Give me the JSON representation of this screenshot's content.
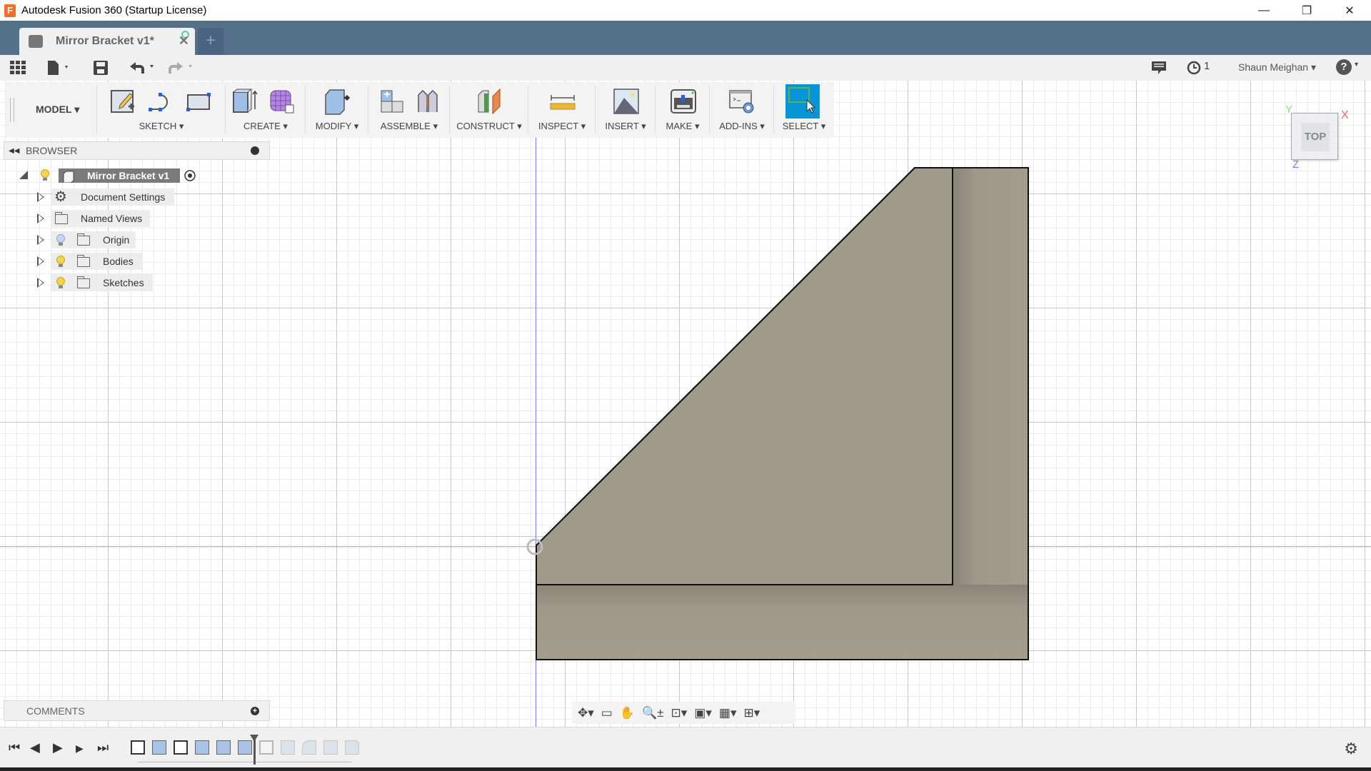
{
  "window": {
    "title": "Autodesk Fusion 360 (Startup License)",
    "logo": "F",
    "controls": {
      "minimize": "—",
      "restore": "❐",
      "close": "✕"
    }
  },
  "tabs": {
    "active": {
      "label": "Mirror Bracket v1*",
      "icon": "cube-icon",
      "close": "✕"
    },
    "new_tab": "+"
  },
  "quick_access": {
    "data_panel": "data-panel-icon",
    "file": "file-icon",
    "save": "save-icon",
    "undo": "undo-icon",
    "redo": "redo-icon",
    "notifications": "comment-icon",
    "job_status": "1",
    "user": "Shaun Meighan ▾",
    "help": "?"
  },
  "toolbar": {
    "workspace": "MODEL ▾",
    "groups": [
      {
        "label": "SKETCH ▾",
        "tools": [
          "create-sketch-icon",
          "spline-icon",
          "rectangle-icon"
        ]
      },
      {
        "label": "CREATE ▾",
        "tools": [
          "extrude-icon",
          "form-icon"
        ]
      },
      {
        "label": "MODIFY ▾",
        "tools": [
          "press-pull-icon"
        ]
      },
      {
        "label": "ASSEMBLE ▾",
        "tools": [
          "new-component-icon",
          "joint-icon"
        ]
      },
      {
        "label": "CONSTRUCT ▾",
        "tools": [
          "plane-icon"
        ]
      },
      {
        "label": "INSPECT ▾",
        "tools": [
          "measure-icon"
        ]
      },
      {
        "label": "INSERT ▾",
        "tools": [
          "insert-image-icon"
        ]
      },
      {
        "label": "MAKE ▾",
        "tools": [
          "3d-print-icon"
        ]
      },
      {
        "label": "ADD-INS ▾",
        "tools": [
          "scripts-addins-icon"
        ]
      },
      {
        "label": "SELECT ▾",
        "tools": [
          "select-icon"
        ]
      }
    ]
  },
  "browser": {
    "title": "BROWSER",
    "root": "Mirror Bracket v1",
    "items": [
      {
        "label": "Document Settings",
        "icon": "gear-icon"
      },
      {
        "label": "Named Views",
        "icon": "folder-icon"
      },
      {
        "label": "Origin",
        "icon": "folder-icon",
        "visible": false
      },
      {
        "label": "Bodies",
        "icon": "folder-icon",
        "visible": true
      },
      {
        "label": "Sketches",
        "icon": "folder-icon",
        "visible": true
      }
    ]
  },
  "viewcube": {
    "face": "TOP",
    "x": "X",
    "y": "Y",
    "z": "Z"
  },
  "comments": {
    "title": "COMMENTS"
  },
  "navbar": {
    "orbit": "✥▾",
    "look_at": "▭",
    "pan": "✋",
    "zoom": "🔍±",
    "fit": "⊡▾",
    "display": "▣▾",
    "grid": "▦▾",
    "viewports": "⊞▾"
  },
  "timeline": {
    "controls": [
      "⏮",
      "◀",
      "▶",
      "▶",
      "⏭"
    ],
    "features": [
      {
        "type": "sketch",
        "active": true
      },
      {
        "type": "extrude",
        "active": true
      },
      {
        "type": "sketch",
        "active": true
      },
      {
        "type": "extrude",
        "active": true
      },
      {
        "type": "extrude",
        "active": true
      },
      {
        "type": "extrude",
        "active": true
      },
      {
        "type": "sketch",
        "active": false
      },
      {
        "type": "extrude",
        "active": false
      },
      {
        "type": "fillet",
        "active": false
      },
      {
        "type": "shell",
        "active": false
      },
      {
        "type": "chamfer",
        "active": false
      }
    ],
    "settings": "⚙"
  },
  "colors": {
    "tabbar": "#557089",
    "body_fill": "#a09a8a",
    "select_active": "#0696d7",
    "axis_x": "#ff8a8a",
    "axis_y": "#7a7aff"
  }
}
